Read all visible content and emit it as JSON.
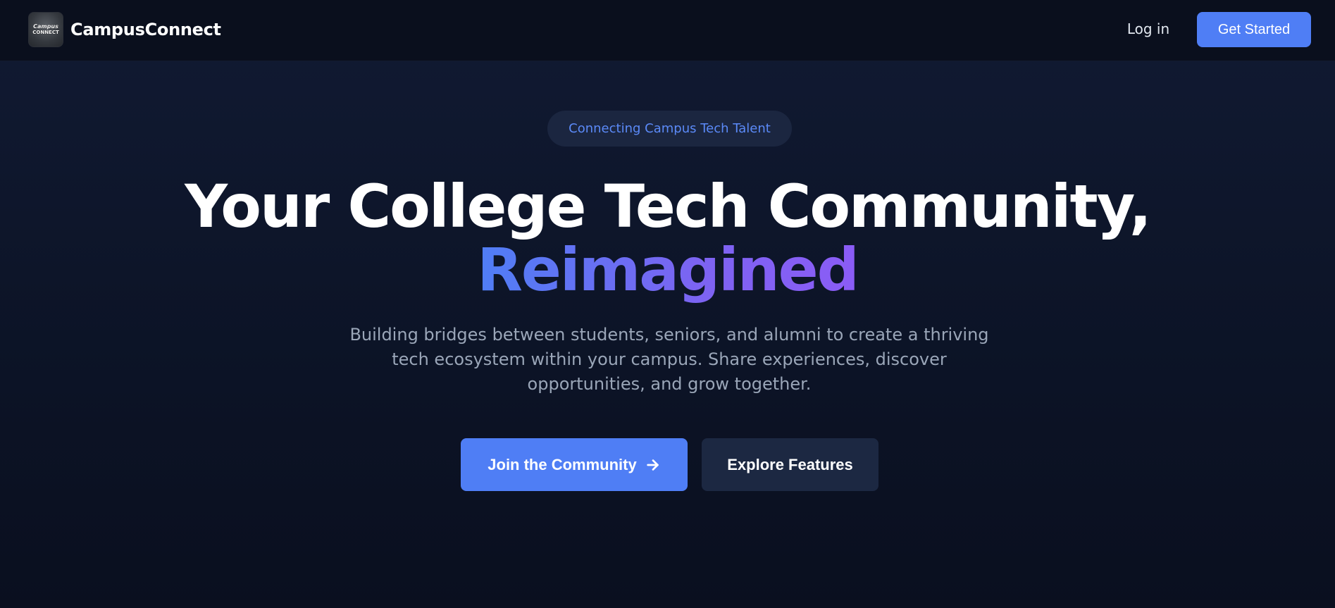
{
  "header": {
    "logo_text_line1": "Campus",
    "logo_text_line2": "CONNECT",
    "brand": "CampusConnect",
    "login_label": "Log in",
    "get_started_label": "Get Started"
  },
  "hero": {
    "badge": "Connecting Campus Tech Talent",
    "headline": "Your College Tech Community,",
    "headline_accent": "Reimagined",
    "description": "Building bridges between students, seniors, and alumni to create a thriving tech ecosystem within your campus. Share experiences, discover opportunities, and grow together.",
    "primary_cta": "Join the Community",
    "primary_cta_icon": "arrow-right-icon",
    "secondary_cta": "Explore Features"
  },
  "colors": {
    "accent": "#4f7ef5",
    "accent_purple": "#8b5cf6",
    "background": "#0b1120",
    "badge_text": "#5b8af8",
    "muted_text": "#9aa6b8"
  }
}
